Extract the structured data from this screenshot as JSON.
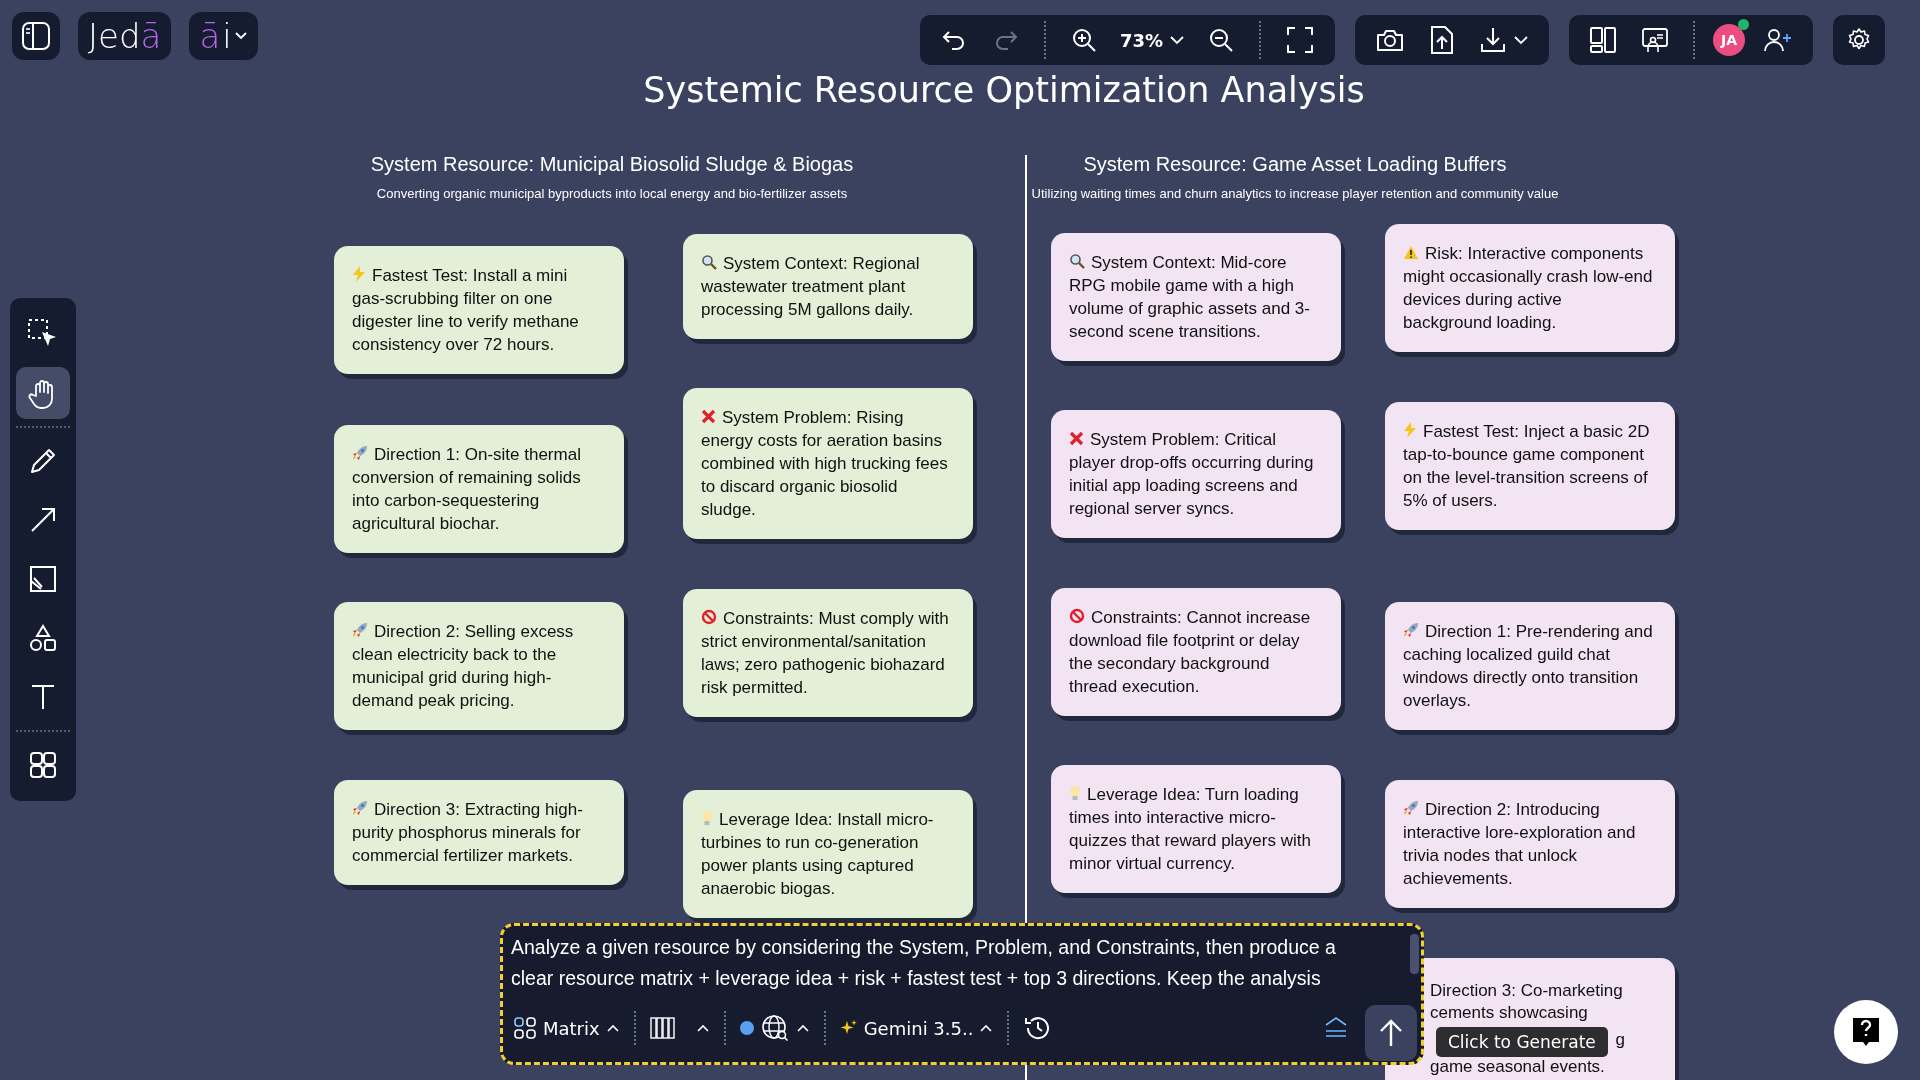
{
  "brand": {
    "logo_plain": "Jed",
    "logo_accent": "ā",
    "ai_accent": "ā",
    "ai_plain": "i"
  },
  "toolbar": {
    "zoom": "73%"
  },
  "avatar": {
    "initials": "JA",
    "online": true
  },
  "tools": [
    {
      "kind": "select",
      "selected": false
    },
    {
      "kind": "hand",
      "selected": true
    },
    {
      "kind": "pen",
      "selected": false
    },
    {
      "kind": "arrow",
      "selected": false
    },
    {
      "kind": "image",
      "selected": false
    },
    {
      "kind": "shapes",
      "selected": false
    },
    {
      "kind": "text",
      "selected": false
    },
    {
      "kind": "grid",
      "selected": false
    }
  ],
  "title": "Systemic Resource Optimization Analysis",
  "columns": [
    {
      "heading": "System Resource: Municipal Biosolid Sludge & Biogas",
      "subheading": "Converting organic municipal byproducts into local energy and bio-fertilizer assets",
      "cards": [
        {
          "kind": "test",
          "text": "Fastest Test: Install a mini gas-scrubbing filter on one digester line to verify methane consistency over 72 hours."
        },
        {
          "kind": "direction",
          "text": "Direction 1: On-site thermal conversion of remaining solids into carbon-sequestering agricultural biochar."
        },
        {
          "kind": "direction",
          "text": "Direction 2: Selling excess clean electricity back to the municipal grid during high-demand peak pricing."
        },
        {
          "kind": "direction",
          "text": "Direction 3: Extracting high-purity phosphorus minerals for commercial fertilizer markets."
        },
        {
          "kind": "context",
          "text": "System Context: Regional wastewater treatment plant processing 5M gallons daily."
        },
        {
          "kind": "problem",
          "text": "System Problem: Rising energy costs for aeration basins combined with high trucking fees to discard organic biosolid sludge."
        },
        {
          "kind": "constraint",
          "text": "Constraints: Must comply with strict environmental/sanitation laws; zero pathogenic biohazard risk permitted."
        },
        {
          "kind": "leverage",
          "text": "Leverage Idea: Install micro-turbines to run co-generation power plants using captured anaerobic biogas."
        }
      ]
    },
    {
      "heading": "System Resource: Game Asset Loading Buffers",
      "subheading": "Utilizing waiting times and churn analytics to increase player retention and community value",
      "cards": [
        {
          "kind": "context",
          "text": "System Context: Mid-core RPG mobile game with a high volume of graphic assets and 3-second scene transitions."
        },
        {
          "kind": "problem",
          "text": "System Problem: Critical player drop-offs occurring during initial app loading screens and regional server syncs."
        },
        {
          "kind": "constraint",
          "text": "Constraints: Cannot increase download file footprint or delay the secondary background thread execution."
        },
        {
          "kind": "leverage",
          "text": "Leverage Idea: Turn loading times into interactive micro-quizzes that reward players with minor virtual currency."
        },
        {
          "kind": "risk",
          "text": "Risk: Interactive components might occasionally crash low-end devices during active background loading."
        },
        {
          "kind": "test",
          "text": "Fastest Test: Inject a basic 2D tap-to-bounce game component on the level-transition screens of 5% of users."
        },
        {
          "kind": "direction",
          "text": "Direction 1: Pre-rendering and caching localized guild chat windows directly onto transition overlays."
        },
        {
          "kind": "direction",
          "text": "Direction 2: Introducing interactive lore-exploration and trivia nodes that unlock achievements."
        },
        {
          "kind": "partial",
          "lines": [
            "Direction 3: Co-marketing",
            "cements showcasing",
            "g",
            "game seasonal events."
          ]
        }
      ]
    }
  ],
  "prompt": {
    "text": "Analyze a given resource by considering the System, Problem, and Constraints, then produce a clear resource matrix + leverage idea + risk + fastest test + top 3 directions. Keep the analysis",
    "mode": "Matrix",
    "model": "Gemini 3.5..",
    "web_search": true
  },
  "tooltip": "Click to Generate"
}
